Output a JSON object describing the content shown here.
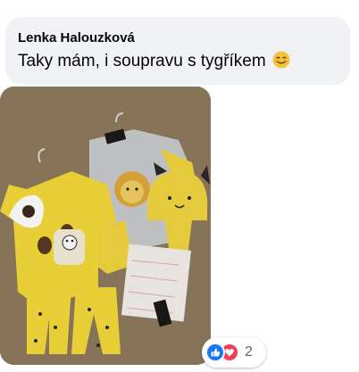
{
  "comment": {
    "author": "Lenka Halouzková",
    "text": "Taky mám, i soupravu s tygříkem",
    "emoji": "smiling-face-emoji"
  },
  "photo": {
    "tag_text": "FUSTAVA"
  },
  "reactions": {
    "types": [
      "like-reaction-icon",
      "love-reaction-icon"
    ],
    "count": "2",
    "colors": {
      "like": "#1877f2",
      "love": "#f33e58"
    }
  }
}
